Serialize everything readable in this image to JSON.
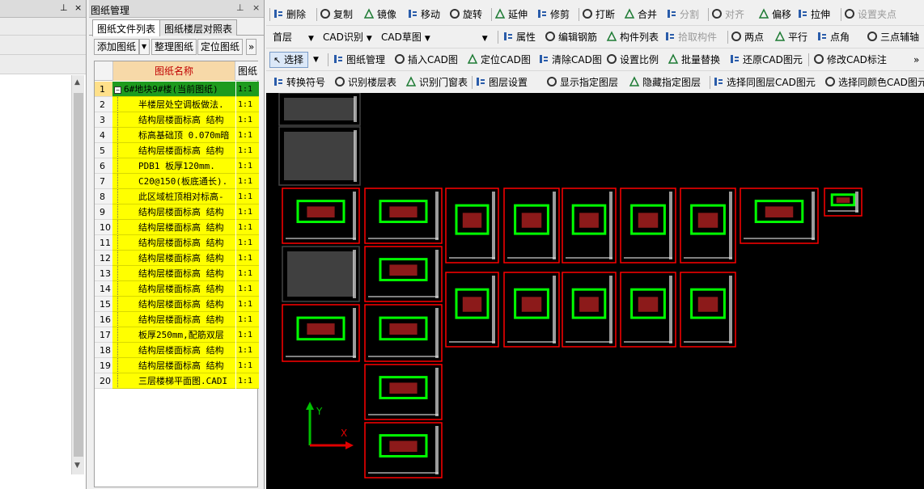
{
  "left_panel": {
    "pin": "⊥",
    "close": "×"
  },
  "drawing_manager": {
    "title": "图纸管理",
    "pin": "⊥",
    "close": "×",
    "tabs": [
      "图纸文件列表",
      "图纸楼层对照表"
    ],
    "buttons": [
      "添加图纸",
      "整理图纸",
      "定位图纸",
      "»"
    ],
    "columns": [
      "图纸名称",
      "图纸"
    ],
    "rows": [
      {
        "n": "1",
        "name": "6#地块9#楼(当前图纸)",
        "scale": "1:1"
      },
      {
        "n": "2",
        "name": "半楼层处空调板做法.",
        "scale": "1:1"
      },
      {
        "n": "3",
        "name": "结构层楼面标高 结构",
        "scale": "1:1"
      },
      {
        "n": "4",
        "name": "标高基础顶 0.070m暗",
        "scale": "1:1"
      },
      {
        "n": "5",
        "name": "结构层楼面标高 结构",
        "scale": "1:1"
      },
      {
        "n": "6",
        "name": "PDB1     板厚120mm.",
        "scale": "1:1"
      },
      {
        "n": "7",
        "name": "C20@150(板底通长).",
        "scale": "1:1"
      },
      {
        "n": "8",
        "name": "此区域桩顶相对标高-",
        "scale": "1:1"
      },
      {
        "n": "9",
        "name": "结构层楼面标高 结构",
        "scale": "1:1"
      },
      {
        "n": "10",
        "name": "结构层楼面标高 结构",
        "scale": "1:1"
      },
      {
        "n": "11",
        "name": "结构层楼面标高 结构",
        "scale": "1:1"
      },
      {
        "n": "12",
        "name": "结构层楼面标高 结构",
        "scale": "1:1"
      },
      {
        "n": "13",
        "name": "结构层楼面标高 结构",
        "scale": "1:1"
      },
      {
        "n": "14",
        "name": "结构层楼面标高 结构",
        "scale": "1:1"
      },
      {
        "n": "15",
        "name": "结构层楼面标高 结构",
        "scale": "1:1"
      },
      {
        "n": "16",
        "name": "结构层楼面标高 结构",
        "scale": "1:1"
      },
      {
        "n": "17",
        "name": "板厚250mm,配筋双层",
        "scale": "1:1"
      },
      {
        "n": "18",
        "name": "结构层楼面标高 结构",
        "scale": "1:1"
      },
      {
        "n": "19",
        "name": "结构层楼面标高 结构",
        "scale": "1:1"
      },
      {
        "n": "20",
        "name": "三层楼梯平面图.CADI",
        "scale": "1:1"
      }
    ]
  },
  "toolbar1": [
    "删除",
    "复制",
    "镜像",
    "移动",
    "旋转",
    "延伸",
    "修剪",
    "打断",
    "合并",
    "分割",
    "对齐",
    "偏移",
    "拉伸",
    "设置夹点"
  ],
  "toolbar2": {
    "floor": "首层",
    "mode": "CAD识别",
    "sub": "CAD草图",
    "items": [
      "属性",
      "编辑钢筋",
      "构件列表",
      "拾取构件",
      "两点",
      "平行",
      "点角",
      "三点辅轴"
    ]
  },
  "toolbar3": {
    "select": "选择",
    "items": [
      "图纸管理",
      "插入CAD图",
      "定位CAD图",
      "清除CAD图",
      "设置比例",
      "批量替换",
      "还原CAD图元",
      "修改CAD标注"
    ],
    "more": "»"
  },
  "toolbar4": [
    "转换符号",
    "识别楼层表",
    "识别门窗表",
    "图层设置",
    "显示指定图层",
    "隐藏指定图层",
    "选择同图层CAD图元",
    "选择同颜色CAD图元"
  ],
  "canvas": {
    "axis_y": "Y",
    "axis_x": "X"
  }
}
